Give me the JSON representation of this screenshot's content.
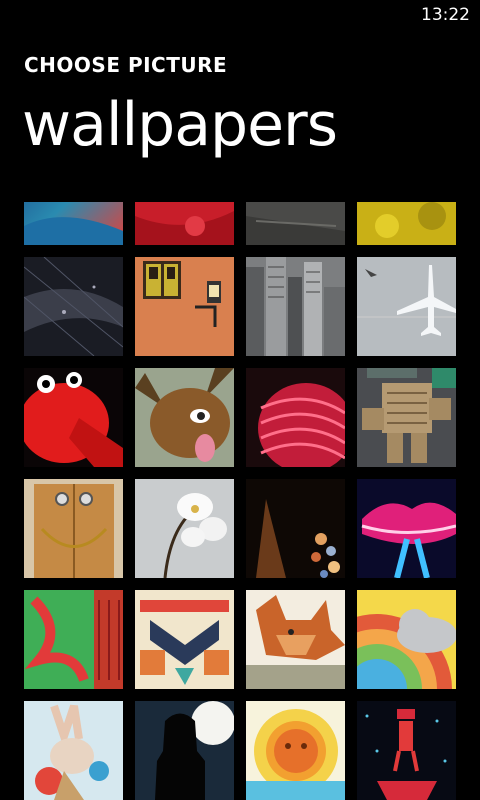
{
  "status": {
    "time": "13:22"
  },
  "header": {
    "subtitle": "CHOOSE PICTURE",
    "title": "wallpapers"
  },
  "tiles": [
    {
      "icon": "blue-feathers"
    },
    {
      "icon": "red-texture"
    },
    {
      "icon": "dark-stone"
    },
    {
      "icon": "yellow-leaves"
    },
    {
      "icon": "dark-mesh"
    },
    {
      "icon": "orange-wall-window"
    },
    {
      "icon": "city-skyline"
    },
    {
      "icon": "airplane-aerial"
    },
    {
      "icon": "red-hydrant-face"
    },
    {
      "icon": "funny-animal"
    },
    {
      "icon": "pink-neon-sculpture"
    },
    {
      "icon": "crate-figure"
    },
    {
      "icon": "wooden-door-face"
    },
    {
      "icon": "white-orchid"
    },
    {
      "icon": "bokeh-lights"
    },
    {
      "icon": "neon-lips"
    },
    {
      "icon": "graffiti-wall"
    },
    {
      "icon": "geometric-totem"
    },
    {
      "icon": "fox-illustration"
    },
    {
      "icon": "rainbow-cloud"
    },
    {
      "icon": "rabbit-illustration"
    },
    {
      "icon": "silhouette-moon"
    },
    {
      "icon": "sun-face"
    },
    {
      "icon": "robot-boat"
    }
  ]
}
